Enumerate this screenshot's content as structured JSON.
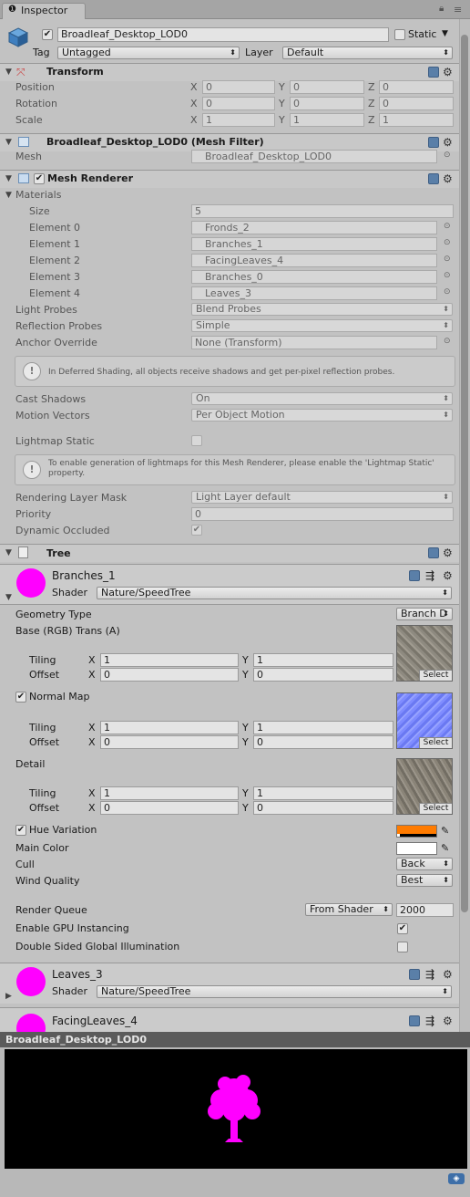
{
  "window": {
    "tab_title": "Inspector"
  },
  "object": {
    "name": "Broadleaf_Desktop_LOD0",
    "active": true,
    "static_label": "Static",
    "tag_label": "Tag",
    "tag_value": "Untagged",
    "layer_label": "Layer",
    "layer_value": "Default"
  },
  "transform": {
    "title": "Transform",
    "position_label": "Position",
    "rotation_label": "Rotation",
    "scale_label": "Scale",
    "axes": [
      "X",
      "Y",
      "Z"
    ],
    "position": [
      "0",
      "0",
      "0"
    ],
    "rotation": [
      "0",
      "0",
      "0"
    ],
    "scale": [
      "1",
      "1",
      "1"
    ]
  },
  "mesh_filter": {
    "title": "Broadleaf_Desktop_LOD0 (Mesh Filter)",
    "mesh_label": "Mesh",
    "mesh_value": "Broadleaf_Desktop_LOD0"
  },
  "mesh_renderer": {
    "title": "Mesh Renderer",
    "materials_label": "Materials",
    "size_label": "Size",
    "size_value": "5",
    "elements": [
      {
        "label": "Element 0",
        "value": "Fronds_2"
      },
      {
        "label": "Element 1",
        "value": "Branches_1"
      },
      {
        "label": "Element 2",
        "value": "FacingLeaves_4"
      },
      {
        "label": "Element 3",
        "value": "Branches_0"
      },
      {
        "label": "Element 4",
        "value": "Leaves_3"
      }
    ],
    "light_probes_label": "Light Probes",
    "light_probes_value": "Blend Probes",
    "reflection_probes_label": "Reflection Probes",
    "reflection_probes_value": "Simple",
    "anchor_label": "Anchor Override",
    "anchor_value": "None (Transform)",
    "deferred_info": "In Deferred Shading, all objects receive shadows and get per-pixel reflection probes.",
    "cast_shadows_label": "Cast Shadows",
    "cast_shadows_value": "On",
    "motion_vectors_label": "Motion Vectors",
    "motion_vectors_value": "Per Object Motion",
    "lightmap_static_label": "Lightmap Static",
    "lightmap_info": "To enable generation of lightmaps for this Mesh Renderer, please enable the 'Lightmap Static' property.",
    "rendering_layer_label": "Rendering Layer Mask",
    "rendering_layer_value": "Light Layer default",
    "priority_label": "Priority",
    "priority_value": "0",
    "dynamic_occluded_label": "Dynamic Occluded"
  },
  "tree": {
    "title": "Tree"
  },
  "material_branches": {
    "name": "Branches_1",
    "shader_label": "Shader",
    "shader_value": "Nature/SpeedTree",
    "geometry_type_label": "Geometry Type",
    "geometry_type_value": "Branch D",
    "base_label": "Base (RGB) Trans (A)",
    "normal_label": "Normal Map",
    "detail_label": "Detail",
    "tiling_label": "Tiling",
    "offset_label": "Offset",
    "x_label": "X",
    "y_label": "Y",
    "base_tiling": [
      "1",
      "1"
    ],
    "base_offset": [
      "0",
      "0"
    ],
    "normal_tiling": [
      "1",
      "1"
    ],
    "normal_offset": [
      "0",
      "0"
    ],
    "detail_tiling": [
      "1",
      "1"
    ],
    "detail_offset": [
      "0",
      "0"
    ],
    "select_label": "Select",
    "hue_variation_label": "Hue Variation",
    "hue_color": "#ff7b00",
    "main_color_label": "Main Color",
    "main_color": "#ffffff",
    "cull_label": "Cull",
    "cull_value": "Back",
    "wind_quality_label": "Wind Quality",
    "wind_quality_value": "Best",
    "render_queue_label": "Render Queue",
    "render_queue_mode": "From Shader",
    "render_queue_value": "2000",
    "gpu_instancing_label": "Enable GPU Instancing",
    "double_sided_gi_label": "Double Sided Global Illumination"
  },
  "material_leaves": {
    "name": "Leaves_3",
    "shader_label": "Shader",
    "shader_value": "Nature/SpeedTree"
  },
  "material_facing": {
    "name": "FacingLeaves_4"
  },
  "preview": {
    "title": "Broadleaf_Desktop_LOD0"
  },
  "colors": {
    "accent": "#ff00ff",
    "panel": "#c2c2c2",
    "preview_bg": "#000000"
  }
}
